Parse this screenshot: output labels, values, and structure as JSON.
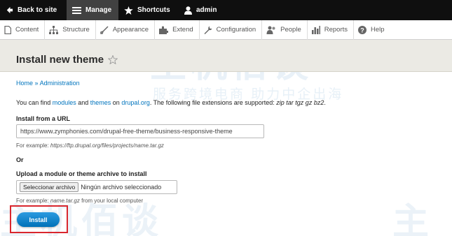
{
  "toolbar": {
    "back_label": "Back to site",
    "manage_label": "Manage",
    "shortcuts_label": "Shortcuts",
    "user_label": "admin"
  },
  "tray": {
    "items": [
      {
        "label": "Content",
        "icon": "content-icon"
      },
      {
        "label": "Structure",
        "icon": "structure-icon"
      },
      {
        "label": "Appearance",
        "icon": "appearance-icon"
      },
      {
        "label": "Extend",
        "icon": "extend-icon"
      },
      {
        "label": "Configuration",
        "icon": "configuration-icon"
      },
      {
        "label": "People",
        "icon": "people-icon"
      },
      {
        "label": "Reports",
        "icon": "reports-icon"
      },
      {
        "label": "Help",
        "icon": "help-icon"
      }
    ]
  },
  "page": {
    "title": "Install new theme"
  },
  "breadcrumb": {
    "home": "Home",
    "separator": "»",
    "admin": "Administration"
  },
  "intro": {
    "part1": "You can find ",
    "modules_link": "modules",
    "part2": " and ",
    "themes_link": "themes",
    "part3": " on ",
    "drupal_link": "drupal.org",
    "part4": ". The following file extensions are supported: ",
    "extensions": "zip tar tgz gz bz2",
    "part5": "."
  },
  "url_field": {
    "label": "Install from a URL",
    "value": "https://www.zymphonies.com/drupal-free-theme/business-responsive-theme",
    "hint_prefix": "For example: ",
    "hint_example": "https://ftp.drupal.org/files/projects/name.tar.gz"
  },
  "or_label": "Or",
  "upload_field": {
    "label": "Upload a module or theme archive to install",
    "button_label": "Seleccionar archivo",
    "status": "Ningún archivo seleccionado",
    "hint_prefix": "For example: ",
    "hint_example": "name.tar.gz",
    "hint_suffix": " from your local computer"
  },
  "install_button": "Install",
  "watermark": {
    "text": "主机佰谈",
    "subtext": "服务跨境电商 助力中企出海",
    "text_bottom": "主机佰谈",
    "text_right": "主"
  },
  "colors": {
    "toolbar_bg": "#0f0f0f",
    "link": "#0074bd",
    "header_bg": "#ebeae4",
    "install_btn": "#0071b8",
    "highlight_box": "#d9262d"
  }
}
